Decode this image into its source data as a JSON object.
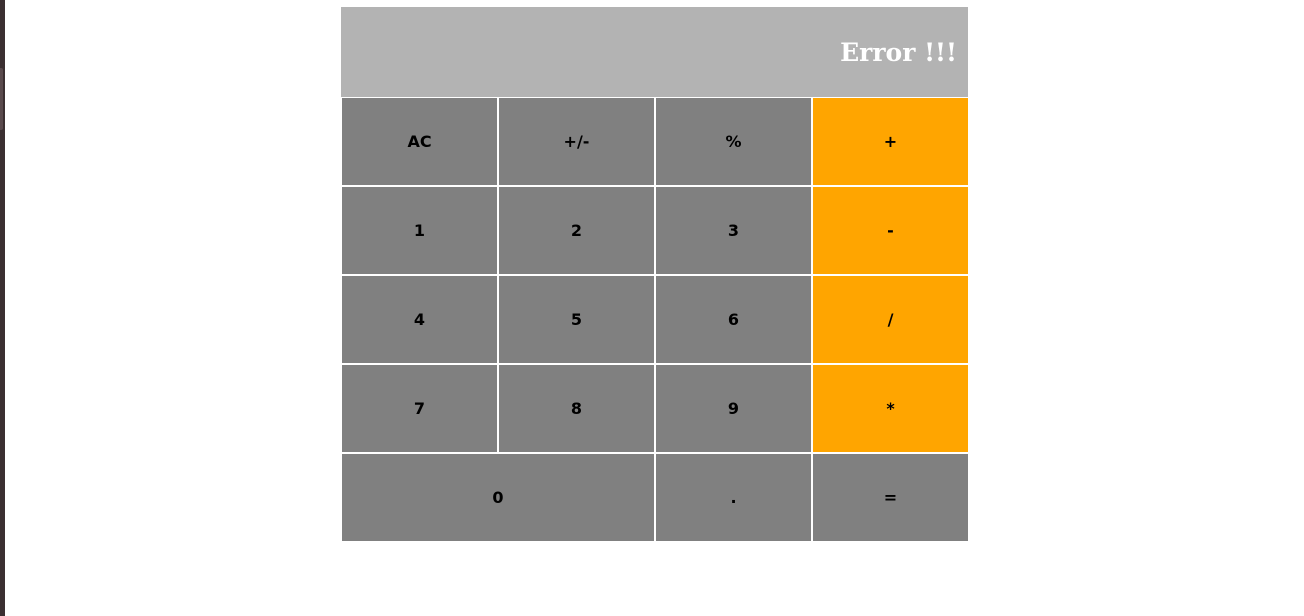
{
  "display": {
    "value": "Error !!!"
  },
  "keys": {
    "ac": "AC",
    "sign": "+/-",
    "percent": "%",
    "add": "+",
    "one": "1",
    "two": "2",
    "three": "3",
    "subtract": "-",
    "four": "4",
    "five": "5",
    "six": "6",
    "divide": "/",
    "seven": "7",
    "eight": "8",
    "nine": "9",
    "multiply": "*",
    "zero": "0",
    "decimal": ".",
    "equals": "="
  },
  "colors": {
    "display_bg": "#b3b3b3",
    "key_bg": "#808080",
    "operator_bg": "#ffa500",
    "display_text": "#ffffff",
    "key_text": "#000000"
  }
}
